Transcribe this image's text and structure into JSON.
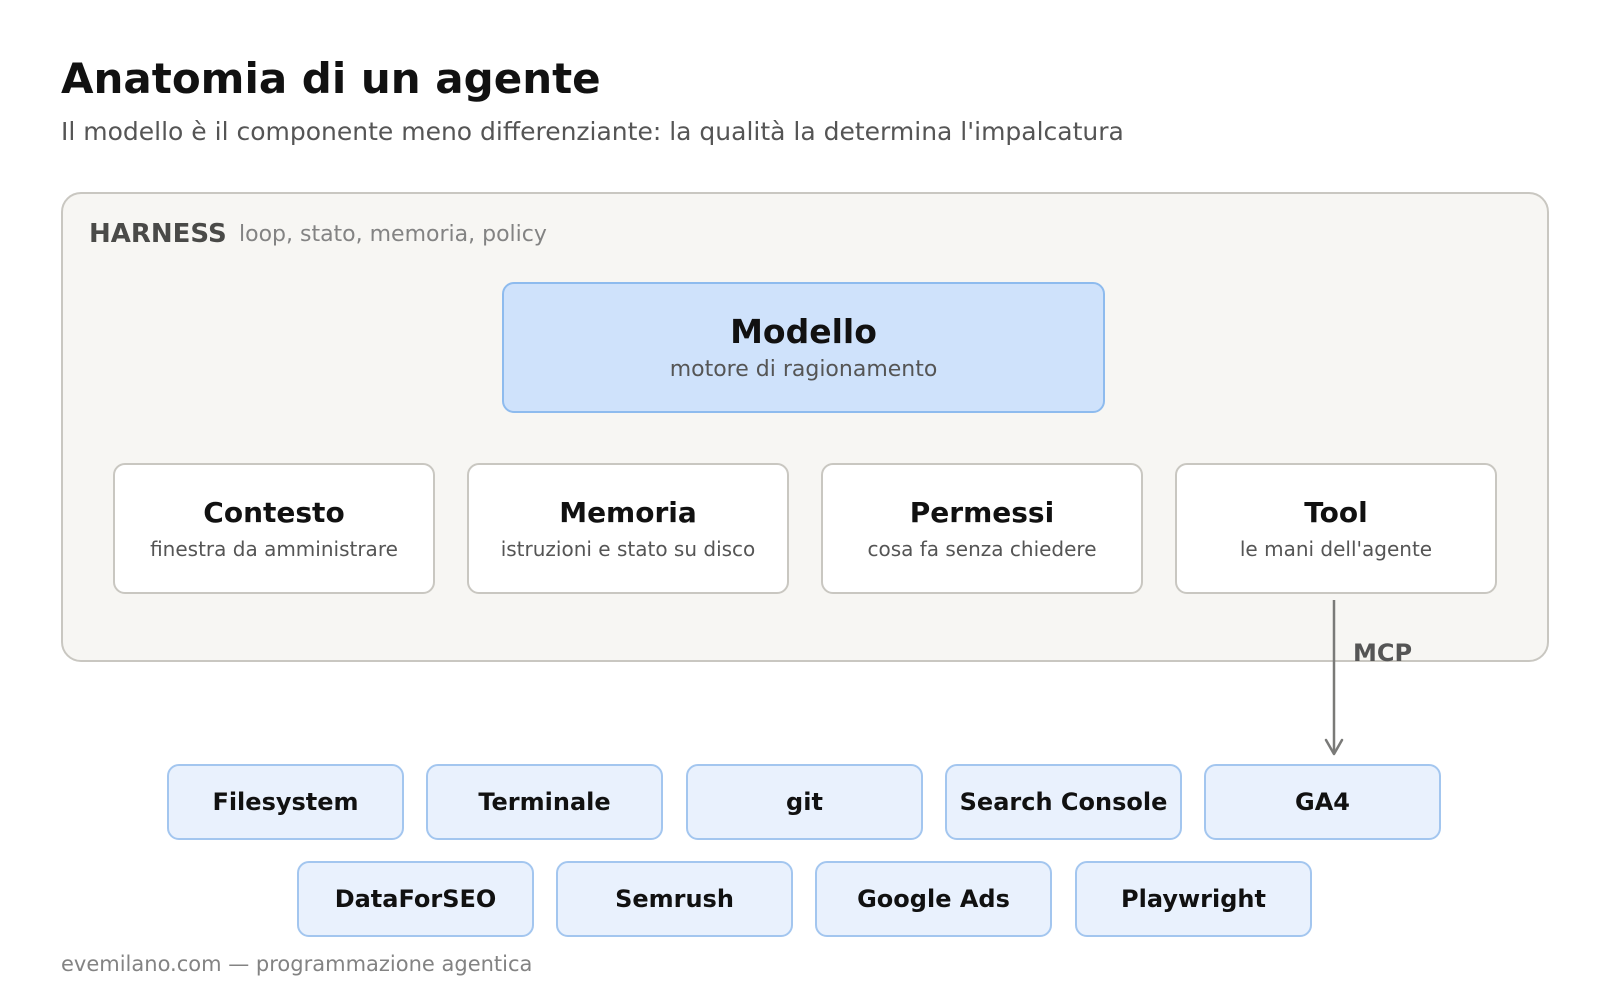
{
  "header": {
    "title": "Anatomia di un agente",
    "subtitle": "Il modello è il componente meno differenziante: la qualità la determina l'impalcatura"
  },
  "harness": {
    "title": "HARNESS",
    "description": "loop, stato, memoria, policy"
  },
  "model": {
    "name": "Modello",
    "description": "motore di ragionamento"
  },
  "components": [
    {
      "name": "Contesto",
      "description": "finestra da amministrare"
    },
    {
      "name": "Memoria",
      "description": "istruzioni e stato su disco"
    },
    {
      "name": "Permessi",
      "description": "cosa fa senza chiedere"
    },
    {
      "name": "Tool",
      "description": "le mani dell'agente"
    }
  ],
  "connector": {
    "label": "MCP"
  },
  "tools_row1": [
    "Filesystem",
    "Terminale",
    "git",
    "Search Console",
    "GA4"
  ],
  "tools_row2": [
    "DataForSEO",
    "Semrush",
    "Google Ads",
    "Playwright"
  ],
  "footer": {
    "text": "evemilano.com — programmazione agentica"
  },
  "colors": {
    "model_fill": "#cfe2fb",
    "model_border": "#8ebbee",
    "tool_fill": "#e9f1fd",
    "tool_border": "#a3c6ef",
    "harness_fill": "#f7f6f3",
    "harness_border": "#c9c7c1",
    "arrow": "#7a7a78"
  }
}
